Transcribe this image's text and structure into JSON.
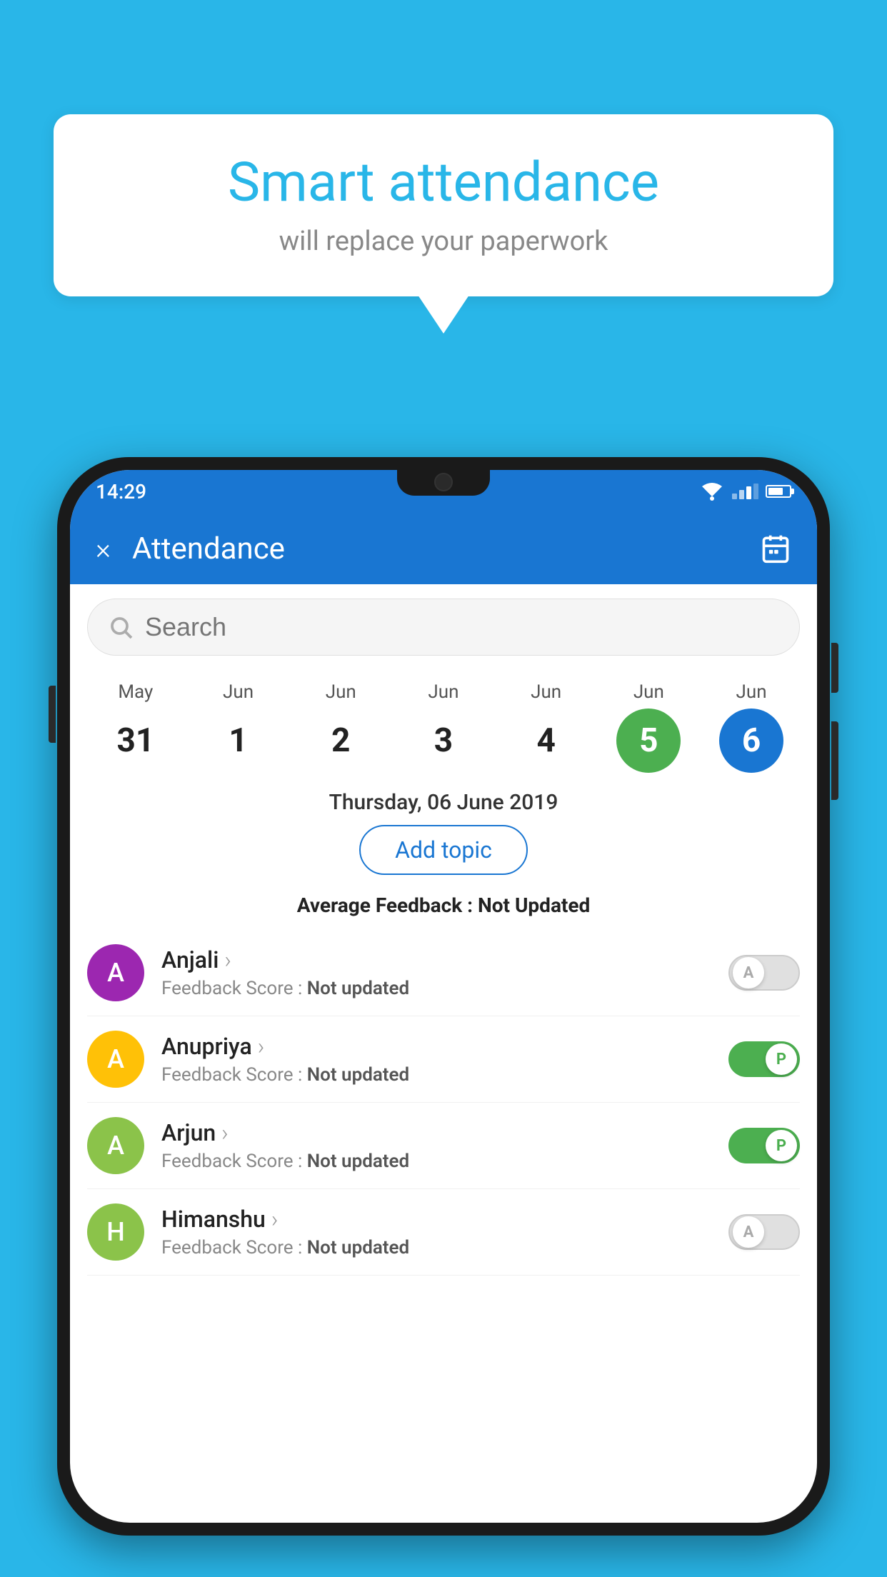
{
  "background": {
    "color": "#29B6E8"
  },
  "bubble": {
    "title": "Smart attendance",
    "subtitle": "will replace your paperwork"
  },
  "phone": {
    "status_bar": {
      "time": "14:29"
    },
    "header": {
      "title": "Attendance",
      "close_label": "×"
    },
    "search": {
      "placeholder": "Search"
    },
    "calendar": {
      "dates": [
        {
          "month": "May",
          "day": "31",
          "state": "normal"
        },
        {
          "month": "Jun",
          "day": "1",
          "state": "normal"
        },
        {
          "month": "Jun",
          "day": "2",
          "state": "normal"
        },
        {
          "month": "Jun",
          "day": "3",
          "state": "normal"
        },
        {
          "month": "Jun",
          "day": "4",
          "state": "normal"
        },
        {
          "month": "Jun",
          "day": "5",
          "state": "today"
        },
        {
          "month": "Jun",
          "day": "6",
          "state": "selected"
        }
      ],
      "selected_date_label": "Thursday, 06 June 2019"
    },
    "add_topic_label": "Add topic",
    "avg_feedback_label": "Average Feedback :",
    "avg_feedback_value": "Not Updated",
    "students": [
      {
        "name": "Anjali",
        "avatar_letter": "A",
        "avatar_color": "#9C27B0",
        "score_label": "Feedback Score :",
        "score_value": "Not updated",
        "toggle_state": "off",
        "toggle_label": "A"
      },
      {
        "name": "Anupriya",
        "avatar_letter": "A",
        "avatar_color": "#FFC107",
        "score_label": "Feedback Score :",
        "score_value": "Not updated",
        "toggle_state": "on",
        "toggle_label": "P"
      },
      {
        "name": "Arjun",
        "avatar_letter": "A",
        "avatar_color": "#8BC34A",
        "score_label": "Feedback Score :",
        "score_value": "Not updated",
        "toggle_state": "on",
        "toggle_label": "P"
      },
      {
        "name": "Himanshu",
        "avatar_letter": "H",
        "avatar_color": "#8BC34A",
        "score_label": "Feedback Score :",
        "score_value": "Not updated",
        "toggle_state": "off",
        "toggle_label": "A"
      }
    ]
  }
}
